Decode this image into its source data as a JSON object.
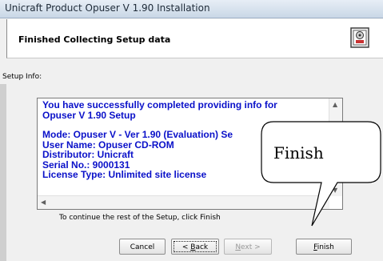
{
  "window": {
    "title": "Unicraft Product Opuser V 1.90 Installation"
  },
  "header": {
    "title": "Finished Collecting Setup data",
    "icon": "installer-package-icon"
  },
  "setup_info_label": "Setup Info:",
  "info_lines": [
    "You have successfully completed providing info for",
    "Opuser V  1.90 Setup",
    "Mode: Opuser V - Ver 1.90 (Evaluation) Se",
    "User Name: Opuser CD-ROM",
    "Distributor: Unicraft",
    "Serial No.: 9000131",
    "License Type: Unlimited site license"
  ],
  "continue_text": "To continue the rest of the Setup, click Finish",
  "buttons": {
    "cancel": "Cancel",
    "back": "< Back",
    "back_prefix": "< ",
    "back_mnemonic": "B",
    "back_rest": "ack",
    "next": "Next >",
    "next_mnemonic": "N",
    "next_rest": "ext >",
    "finish": "Finish",
    "finish_mnemonic": "F",
    "finish_rest": "inish"
  },
  "callout": {
    "text": "Finish"
  },
  "colors": {
    "info_text": "#0a11c9",
    "window_bg": "#f0f0f0"
  }
}
